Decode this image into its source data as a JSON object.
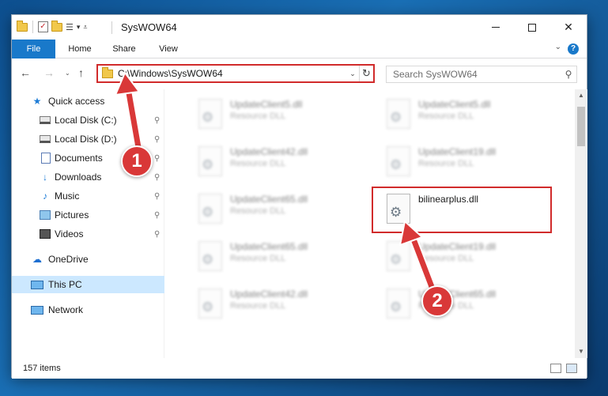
{
  "window": {
    "title": "SysWOW64",
    "controls": {
      "minimize": "–",
      "maximize": "□",
      "close": "✕"
    }
  },
  "ribbon": {
    "tabs": [
      "File",
      "Home",
      "Share",
      "View"
    ],
    "help": "?",
    "collapse": "⌄"
  },
  "navigation": {
    "back": "←",
    "forward": "→",
    "recent": "⌄",
    "up": "↑",
    "address": "C:\\Windows\\SysWOW64",
    "refresh": "↻",
    "search_placeholder": "Search SysWOW64"
  },
  "sidebar": {
    "items": [
      {
        "label": "Quick access",
        "icon": "star-icon",
        "pinned": false
      },
      {
        "label": "Local Disk (C:)",
        "icon": "disk-icon",
        "pinned": true
      },
      {
        "label": "Local Disk (D:)",
        "icon": "disk-icon",
        "pinned": true
      },
      {
        "label": "Documents",
        "icon": "document-icon",
        "pinned": true
      },
      {
        "label": "Downloads",
        "icon": "download-icon",
        "pinned": true
      },
      {
        "label": "Music",
        "icon": "music-icon",
        "pinned": true
      },
      {
        "label": "Pictures",
        "icon": "pictures-icon",
        "pinned": true
      },
      {
        "label": "Videos",
        "icon": "videos-icon",
        "pinned": true
      },
      {
        "label": "OneDrive",
        "icon": "cloud-icon",
        "pinned": false
      },
      {
        "label": "This PC",
        "icon": "computer-icon",
        "pinned": false,
        "selected": true
      },
      {
        "label": "Network",
        "icon": "network-icon",
        "pinned": false
      }
    ],
    "pin_glyph": "📌"
  },
  "files": [
    {
      "name": "UpdateClient5.dll",
      "type": "Resource DLL",
      "blurred": true
    },
    {
      "name": "UpdateClient5.dll",
      "type": "Resource DLL",
      "blurred": true
    },
    {
      "name": "UpdateClient42.dll",
      "type": "Resource DLL",
      "blurred": true
    },
    {
      "name": "UpdateClient19.dll",
      "type": "Resource DLL",
      "blurred": true
    },
    {
      "name": "UpdateClient65.dll",
      "type": "Resource DLL",
      "blurred": true
    },
    {
      "name": "bilinearplus.dll",
      "type": "",
      "blurred": false,
      "highlighted": true
    },
    {
      "name": "UpdateClient65.dll",
      "type": "Resource DLL",
      "blurred": true
    },
    {
      "name": "UpdateClient19.dll",
      "type": "Resource DLL",
      "blurred": true
    },
    {
      "name": "UpdateClient42.dll",
      "type": "Resource DLL",
      "blurred": true
    },
    {
      "name": "UpdateClient65.dll",
      "type": "Resource DLL",
      "blurred": true
    }
  ],
  "status": {
    "item_count": "157 items"
  },
  "callouts": [
    {
      "number": "1",
      "target": "address-bar"
    },
    {
      "number": "2",
      "target": "bilinearplus.dll"
    }
  ],
  "colors": {
    "accent": "#1979ca",
    "highlight_red": "#d12b2b",
    "selected_bg": "#cce8ff"
  }
}
